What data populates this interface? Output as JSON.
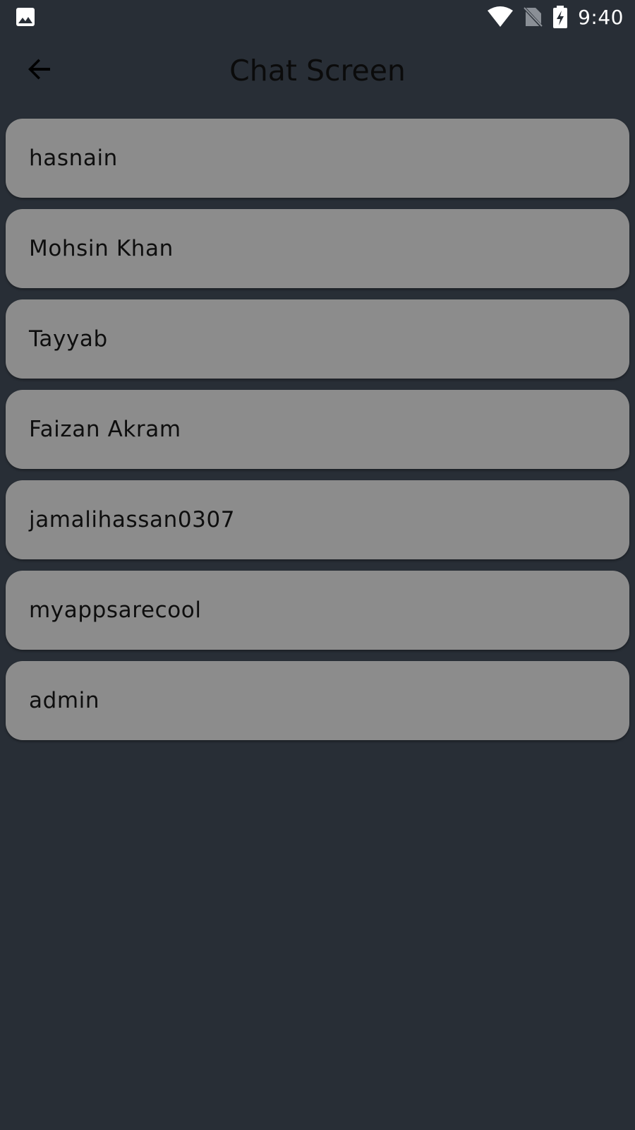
{
  "status_bar": {
    "left_icon": "image-icon",
    "icons": [
      "wifi-icon",
      "no-sim-icon",
      "battery-charging-icon"
    ],
    "time": "9:40"
  },
  "app_bar": {
    "back_icon": "arrow-back-icon",
    "title": "Chat Screen"
  },
  "chats": [
    {
      "name": "hasnain"
    },
    {
      "name": "Mohsin Khan"
    },
    {
      "name": "Tayyab"
    },
    {
      "name": "Faizan Akram"
    },
    {
      "name": "jamalihassan0307"
    },
    {
      "name": "myappsarecool"
    },
    {
      "name": "admin"
    }
  ],
  "colors": {
    "background": "#282e36",
    "list_item": "#8c8c8c",
    "text": "#0e0e0e",
    "status_text": "#ffffff"
  }
}
